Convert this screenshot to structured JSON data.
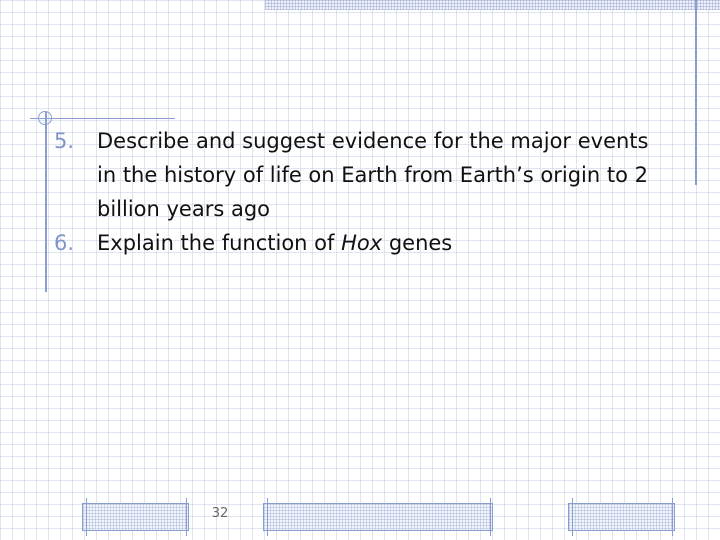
{
  "slide": {
    "objectives": [
      {
        "number": "5.",
        "text_parts": [
          "Describe and suggest evidence for the major events in the history of life on Earth from Earth’s origin to 2 billion years ago"
        ]
      },
      {
        "number": "6.",
        "text_before": "Explain the function of ",
        "text_italic": "Hox",
        "text_after": " genes"
      }
    ],
    "page_number": "32"
  },
  "theme": {
    "accent_color": "#8a9fcf",
    "number_color": "#7f95c9",
    "text_color": "#111111"
  }
}
